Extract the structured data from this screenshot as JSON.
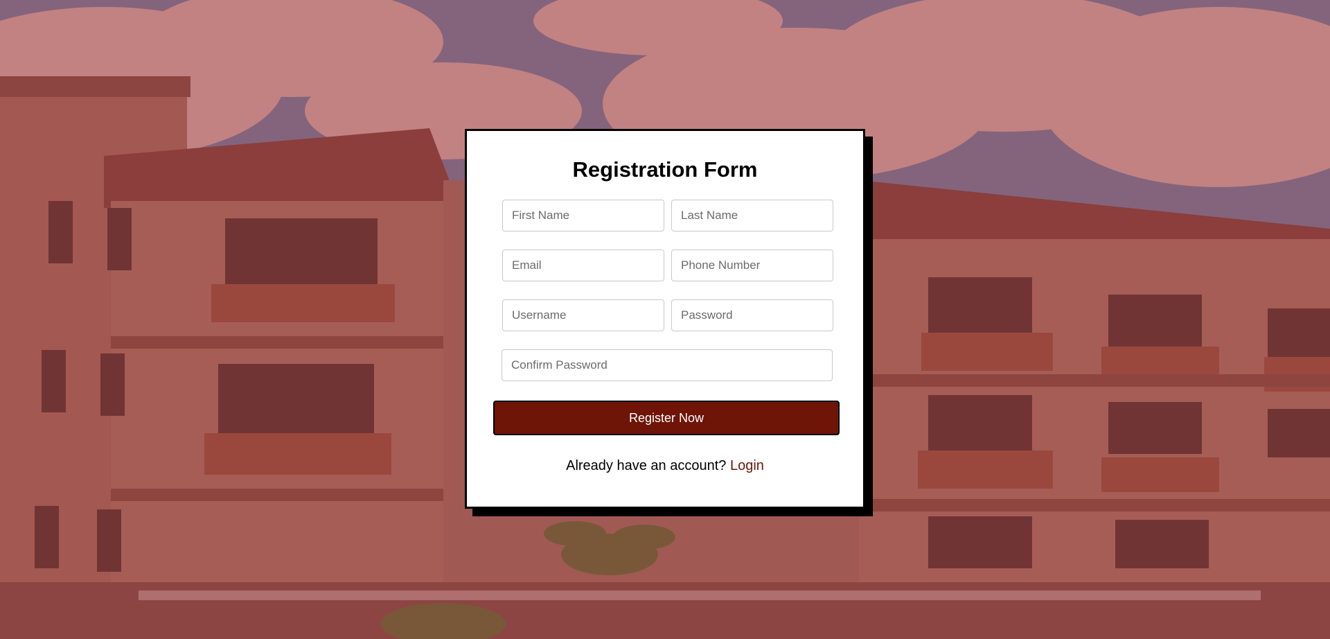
{
  "form": {
    "title": "Registration Form",
    "fields": {
      "first_name": {
        "placeholder": "First Name",
        "value": ""
      },
      "last_name": {
        "placeholder": "Last Name",
        "value": ""
      },
      "email": {
        "placeholder": "Email",
        "value": ""
      },
      "phone": {
        "placeholder": "Phone Number",
        "value": ""
      },
      "username": {
        "placeholder": "Username",
        "value": ""
      },
      "password": {
        "placeholder": "Password",
        "value": ""
      },
      "confirm_password": {
        "placeholder": "Confirm Password",
        "value": ""
      }
    },
    "submit_label": "Register Now",
    "login_prompt": "Already have an account?",
    "login_link": "Login"
  },
  "colors": {
    "accent": "#6e1507",
    "card_background": "#ffffff",
    "card_border": "#000000"
  }
}
